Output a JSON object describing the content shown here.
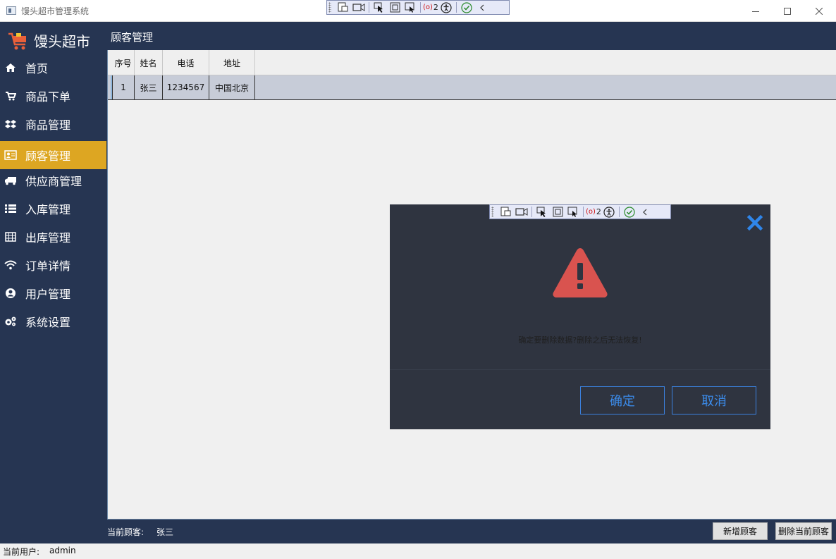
{
  "window": {
    "title": "馒头超市管理系统"
  },
  "debug_toolbar": {
    "binding_count": "2",
    "icons": [
      "select-element-icon",
      "record-icon",
      "pointer-icon",
      "layout-adorner-icon",
      "track-focus-icon",
      "binding-failures-icon",
      "accessibility-icon",
      "validation-ok-icon",
      "collapse-icon"
    ]
  },
  "brand": {
    "name": "馒头超市"
  },
  "page": {
    "title": "顾客管理"
  },
  "sidebar": {
    "items": [
      {
        "label": "首页",
        "icon": "home-icon"
      },
      {
        "label": "商品下单",
        "icon": "cart-icon"
      },
      {
        "label": "商品管理",
        "icon": "dropbox-icon"
      },
      {
        "label": "顾客管理",
        "icon": "id-card-icon",
        "active": true
      },
      {
        "label": "供应商管理",
        "icon": "truck-icon"
      },
      {
        "label": "入库管理",
        "icon": "list-icon"
      },
      {
        "label": "出库管理",
        "icon": "table-icon"
      },
      {
        "label": "订单详情",
        "icon": "wifi-icon"
      },
      {
        "label": "用户管理",
        "icon": "user-circle-icon"
      },
      {
        "label": "系统设置",
        "icon": "cogs-icon"
      }
    ]
  },
  "table": {
    "columns": [
      "序号",
      "姓名",
      "电话",
      "地址"
    ],
    "rows": [
      [
        "1",
        "张三",
        "1234567",
        "中国北京"
      ]
    ]
  },
  "footer": {
    "current_customer_label": "当前顾客:",
    "current_customer_value": "张三",
    "add_button": "新增顾客",
    "delete_button": "删除当前顾客"
  },
  "statusbar": {
    "user_label": "当前用户:",
    "user_value": "admin"
  },
  "dialog": {
    "message": "确定要删除数据?删除之后无法恢复!",
    "confirm": "确定",
    "cancel": "取消"
  },
  "colors": {
    "header_bg": "#263552",
    "active_item": "#dda622",
    "dialog_bg": "#2f3440",
    "dialog_accent": "#3b82e0",
    "warning": "#d9534f"
  }
}
